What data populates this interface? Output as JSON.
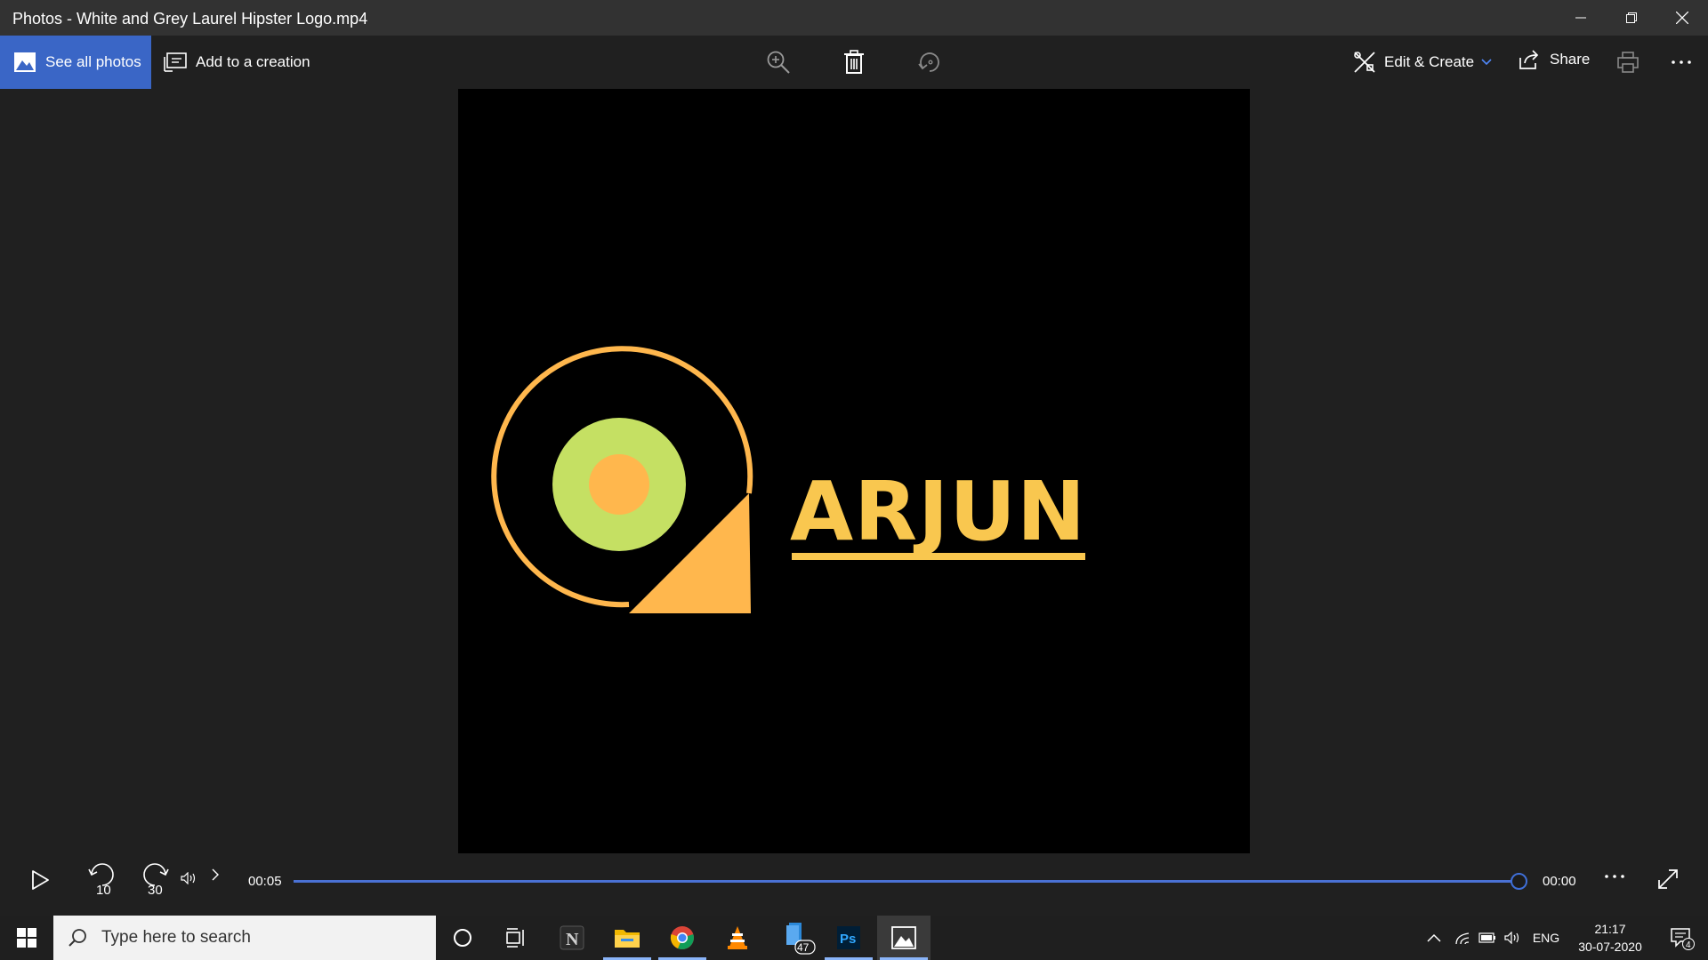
{
  "window": {
    "title": "Photos - White and Grey Laurel Hipster Logo.mp4"
  },
  "toolbar": {
    "see_all_photos": "See all photos",
    "add_to_creation": "Add to a creation",
    "edit_create": "Edit & Create",
    "share": "Share",
    "icons": [
      "zoom-in-icon",
      "delete-icon",
      "rotate-icon",
      "print-icon",
      "more-icon"
    ]
  },
  "media": {
    "logo_text": "ARJUN"
  },
  "player": {
    "elapsed": "00:05",
    "remaining": "00:00",
    "rewind_seconds": "10",
    "forward_seconds": "30",
    "progress": 1.0
  },
  "taskbar": {
    "search_placeholder": "Type here to search",
    "apps": [
      "cortana",
      "task-view",
      "notion",
      "file-explorer",
      "chrome",
      "vlc",
      "mail",
      "photoshop",
      "photos"
    ],
    "mail_badge": "47",
    "photoshop_label": "Ps",
    "language": "ENG",
    "time": "21:17",
    "date": "30-07-2020",
    "notification_count": "4"
  },
  "colors": {
    "accent": "#3a66c6",
    "logo_yellow": "#f9c74f",
    "logo_orange": "#ffb74d",
    "logo_green": "#c5e063",
    "seek": "#4a71d4"
  }
}
